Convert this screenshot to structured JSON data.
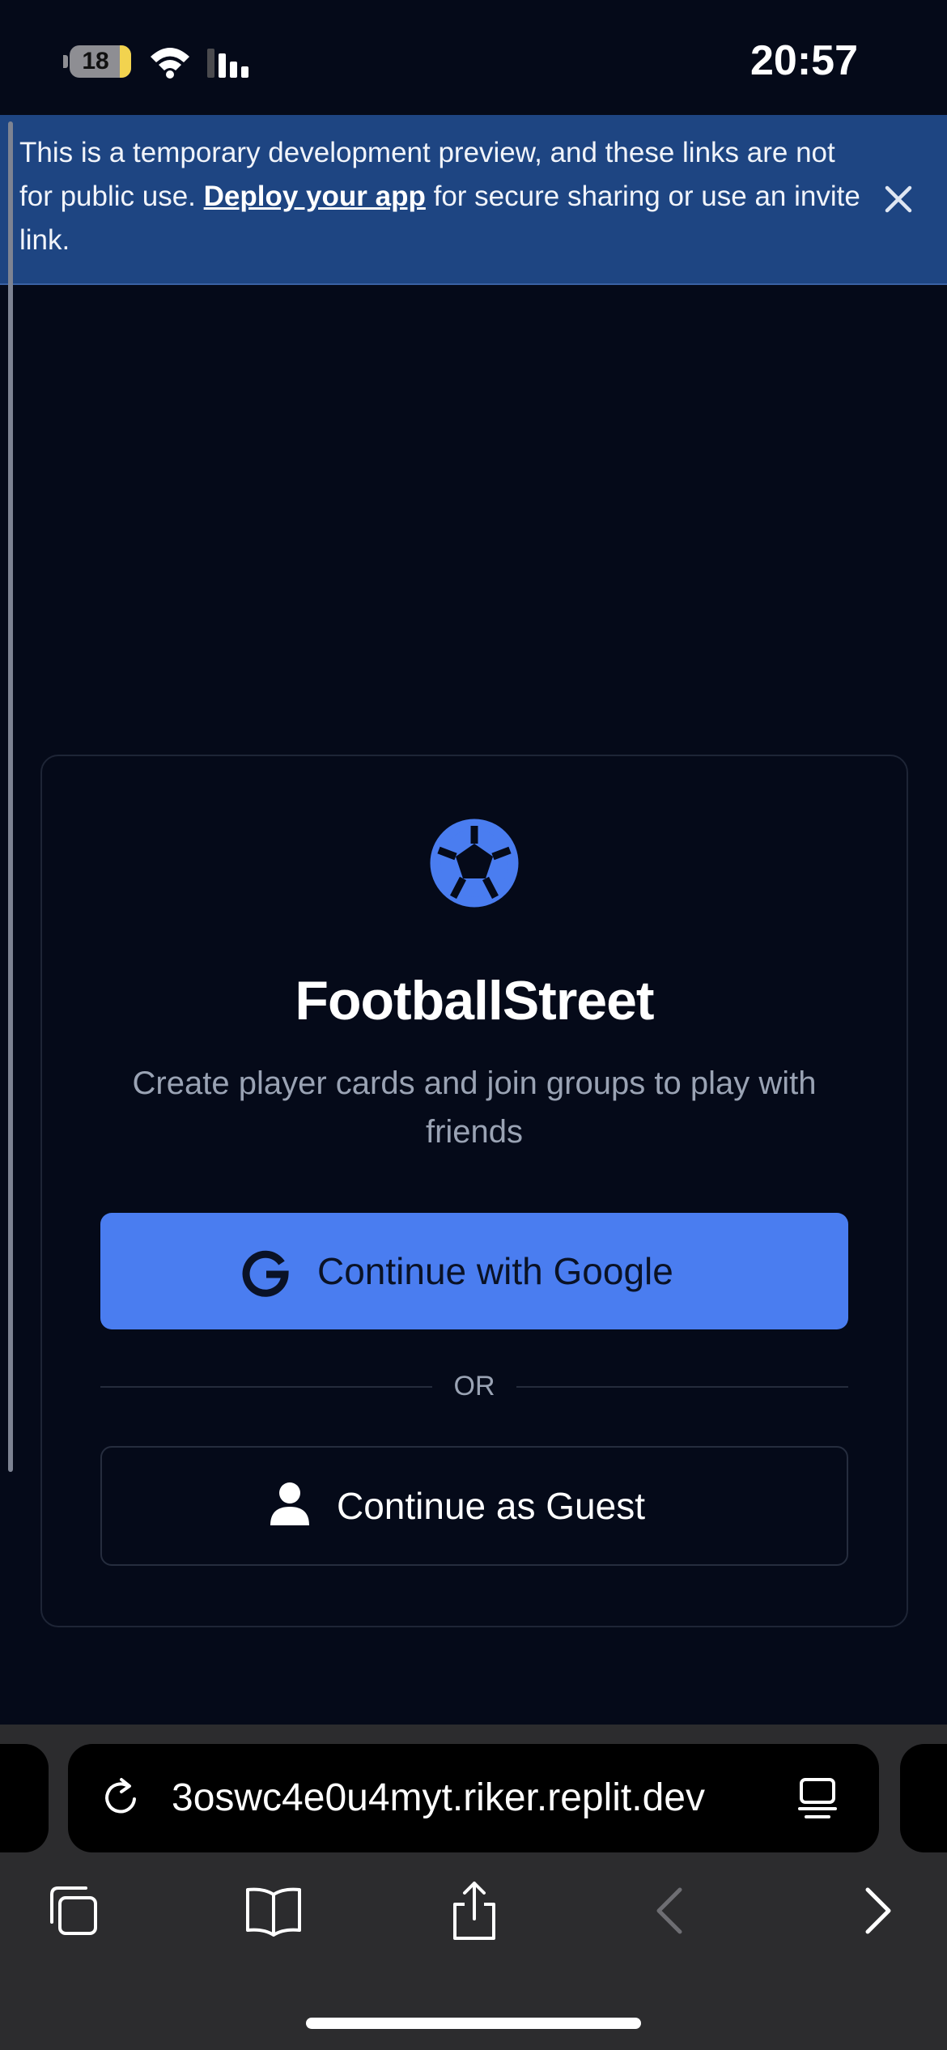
{
  "status_bar": {
    "battery_level": "18",
    "time": "20:57",
    "battery_color": "#f2d34f"
  },
  "banner": {
    "text_before": "This is a temporary development preview, and these links are not for public use.",
    "link_text": "Deploy your app",
    "text_after": "for secure sharing or use an invite link.",
    "close_icon": "close-icon",
    "background": "#1e4582"
  },
  "login_card": {
    "logo_icon": "soccer-ball-icon",
    "title": "FootballStreet",
    "subtitle": "Create player cards and join groups to play with friends",
    "google_button": {
      "label": "Continue with Google",
      "icon": "google-icon",
      "color": "#4a7df0"
    },
    "divider_text": "OR",
    "guest_button": {
      "label": "Continue as Guest",
      "icon": "person-icon"
    }
  },
  "browser": {
    "url": "3oswc4e0u4myt.riker.replit.dev",
    "toolbar": [
      "tabs-icon",
      "bookmarks-icon",
      "share-icon",
      "back-icon",
      "forward-icon"
    ]
  }
}
